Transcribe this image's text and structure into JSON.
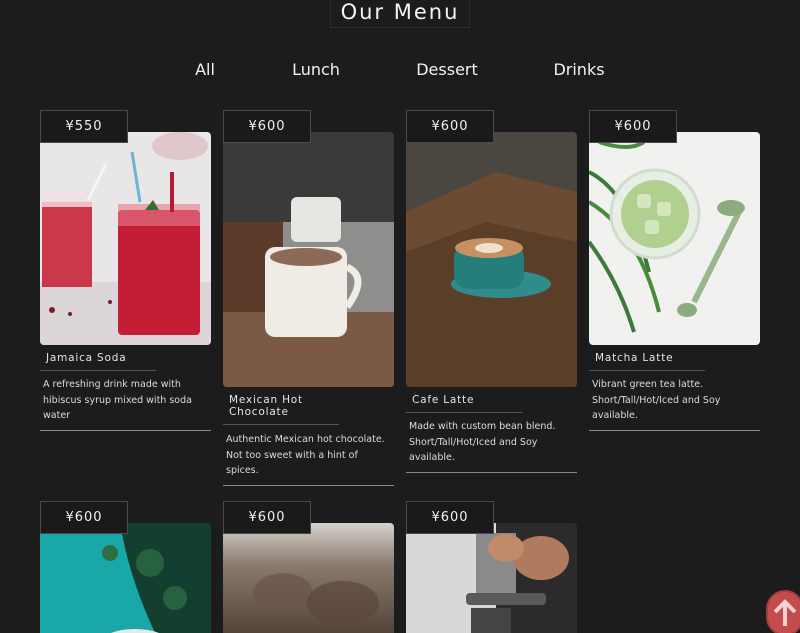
{
  "header": {
    "title": "Our Menu"
  },
  "tabs": [
    {
      "label": "All"
    },
    {
      "label": "Lunch"
    },
    {
      "label": "Dessert"
    },
    {
      "label": "Drinks"
    }
  ],
  "menu_items": [
    {
      "price": "¥550",
      "name": "Jamaica Soda",
      "description": "A refreshing drink made with hibiscus syrup mixed with soda water",
      "image": "red-soda-glasses"
    },
    {
      "price": "¥600",
      "name": "Mexican Hot Chocolate",
      "description": "Authentic Mexican hot chocolate. Not too sweet with a hint of spices.",
      "image": "hot-chocolate-mug"
    },
    {
      "price": "¥600",
      "name": "Cafe Latte",
      "description": "Made with custom bean blend. Short/Tall/Hot/Iced and Soy available.",
      "image": "latte-cup-on-wood"
    },
    {
      "price": "¥600",
      "name": "Matcha Latte",
      "description": "Vibrant green tea latte. Short/Tall/Hot/Iced and Soy available.",
      "image": "iced-matcha-glass"
    },
    {
      "price": "¥600",
      "image": "teal-table-plants"
    },
    {
      "price": "¥600",
      "image": "blurred-dessert"
    },
    {
      "price": "¥600",
      "image": "espresso-machine"
    }
  ],
  "scroll_top": {
    "icon": "arrow-up-icon",
    "color": "#c44c4c"
  }
}
